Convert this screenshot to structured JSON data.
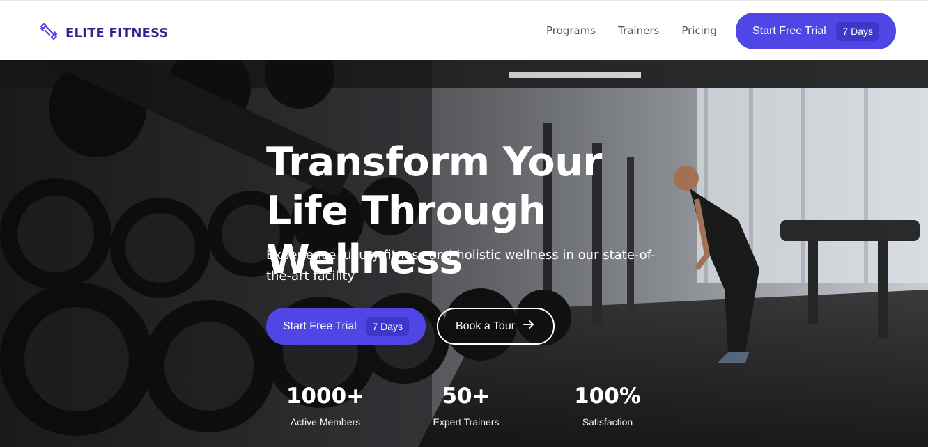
{
  "brand": {
    "name": "ELITE FITNESS",
    "icon": "dumbbell-icon",
    "color": "#3b1d8f"
  },
  "nav": {
    "items": [
      "Programs",
      "Trainers",
      "Pricing"
    ]
  },
  "header_cta": {
    "label": "Start Free Trial",
    "badge": "7 Days"
  },
  "hero": {
    "title": "Transform Your Life Through Wellness",
    "subtitle": "Experience luxury fitness and holistic wellness in our state-of-the-art facility",
    "primary_cta": {
      "label": "Start Free Trial",
      "badge": "7 Days"
    },
    "secondary_cta": {
      "label": "Book a Tour",
      "icon": "arrow-right-icon"
    },
    "stats": [
      {
        "value": "1000+",
        "label": "Active Members"
      },
      {
        "value": "50+",
        "label": "Expert Trainers"
      },
      {
        "value": "100%",
        "label": "Satisfaction"
      }
    ]
  },
  "colors": {
    "accent": "#4f46e5",
    "accent_dark": "#3f37c9",
    "text_light": "#ffffff"
  }
}
